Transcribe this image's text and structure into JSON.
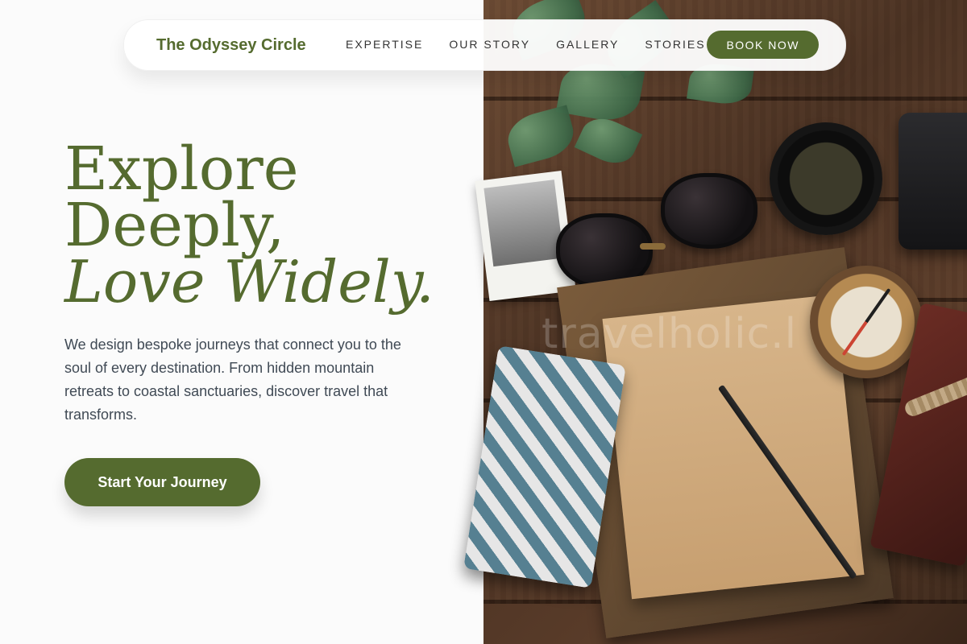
{
  "brand": {
    "name": "The Odyssey Circle"
  },
  "nav": {
    "links": [
      "EXPERTISE",
      "OUR STORY",
      "GALLERY",
      "STORIES"
    ],
    "cta_label": "BOOK NOW"
  },
  "hero": {
    "headline_line1": "Explore",
    "headline_line2": "Deeply,",
    "headline_line3": "Love Widely.",
    "subtext": "We design bespoke journeys that connect you to the soul of every destination. From hidden mountain retreats to coastal sanctuaries, discover travel that transforms.",
    "primary_cta": "Start Your Journey"
  },
  "image": {
    "watermark_text": "travelholic.l",
    "objects": [
      "leaf-icon",
      "polaroid-photo",
      "sunglasses",
      "lens-cap",
      "camera",
      "map",
      "notebook",
      "pencil",
      "compass",
      "tile-book",
      "leather-journal",
      "twine"
    ]
  },
  "colors": {
    "accent": "#556b2f",
    "text": "#404a55",
    "background": "#fbfbfb"
  }
}
